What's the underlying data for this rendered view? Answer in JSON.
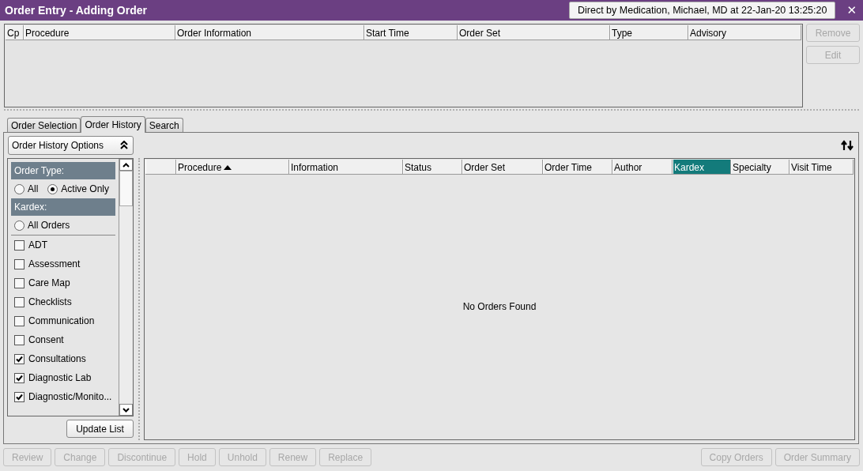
{
  "window": {
    "title": "Order Entry - Adding Order",
    "context": "Direct by Medication, Michael, MD at 22-Jan-20 13:25:20",
    "close": "✕"
  },
  "orders_table": {
    "columns": [
      "Cp",
      "Procedure",
      "Order Information",
      "Start Time",
      "Order Set",
      "Type",
      "Advisory"
    ]
  },
  "side_buttons": [
    {
      "label": "Remove",
      "disabled": true
    },
    {
      "label": "Edit",
      "disabled": true
    }
  ],
  "tabs": [
    {
      "label": "Order Selection",
      "selected": false
    },
    {
      "label": "Order History",
      "selected": true
    },
    {
      "label": "Search",
      "selected": false
    }
  ],
  "options_toggle": {
    "label": "Order History Options",
    "expanded": true
  },
  "filters": [
    {
      "kind": "header",
      "label": "Order Type:"
    },
    {
      "kind": "radios",
      "options": [
        {
          "label": "All",
          "selected": false
        },
        {
          "label": "Active Only",
          "selected": true
        }
      ]
    },
    {
      "kind": "header",
      "label": "Kardex:"
    },
    {
      "kind": "radios",
      "options": [
        {
          "label": "All Orders",
          "selected": false
        }
      ]
    },
    {
      "kind": "separator"
    },
    {
      "kind": "checkbox",
      "label": "ADT",
      "checked": false
    },
    {
      "kind": "checkbox",
      "label": "Assessment",
      "checked": false
    },
    {
      "kind": "checkbox",
      "label": "Care Map",
      "checked": false
    },
    {
      "kind": "checkbox",
      "label": "Checklists",
      "checked": false
    },
    {
      "kind": "checkbox",
      "label": "Communication",
      "checked": false
    },
    {
      "kind": "checkbox",
      "label": "Consent",
      "checked": false
    },
    {
      "kind": "checkbox",
      "label": "Consultations",
      "checked": true
    },
    {
      "kind": "checkbox",
      "label": "Diagnostic Lab",
      "checked": true
    },
    {
      "kind": "checkbox",
      "label": "Diagnostic/Monito...",
      "checked": true
    }
  ],
  "update_button": "Update List",
  "history_table": {
    "columns": [
      {
        "sorted": false,
        "selected": false
      },
      {
        "label": "Procedure",
        "sorted": true,
        "selected": false
      },
      {
        "label": "Information",
        "sorted": false,
        "selected": false
      },
      {
        "label": "Status",
        "sorted": false,
        "selected": false
      },
      {
        "label": "Order Set",
        "sorted": false,
        "selected": false
      },
      {
        "label": "Order Time",
        "sorted": false,
        "selected": false
      },
      {
        "label": "Author",
        "sorted": false,
        "selected": false
      },
      {
        "label": "Kardex",
        "sorted": false,
        "selected": true
      },
      {
        "label": "Specialty",
        "sorted": false,
        "selected": false
      },
      {
        "label": "Visit Time",
        "sorted": false,
        "selected": false
      }
    ],
    "empty_message": "No Orders Found"
  },
  "bottom_buttons_left": [
    {
      "label": "Review",
      "disabled": true
    },
    {
      "label": "Change",
      "disabled": true
    },
    {
      "label": "Discontinue",
      "disabled": true
    },
    {
      "label": "Hold",
      "disabled": true
    },
    {
      "label": "Unhold",
      "disabled": true
    },
    {
      "label": "Renew",
      "disabled": true
    },
    {
      "label": "Replace",
      "disabled": true
    }
  ],
  "bottom_buttons_right": [
    {
      "label": "Copy Orders",
      "disabled": true
    },
    {
      "label": "Order Summary",
      "disabled": true
    }
  ]
}
